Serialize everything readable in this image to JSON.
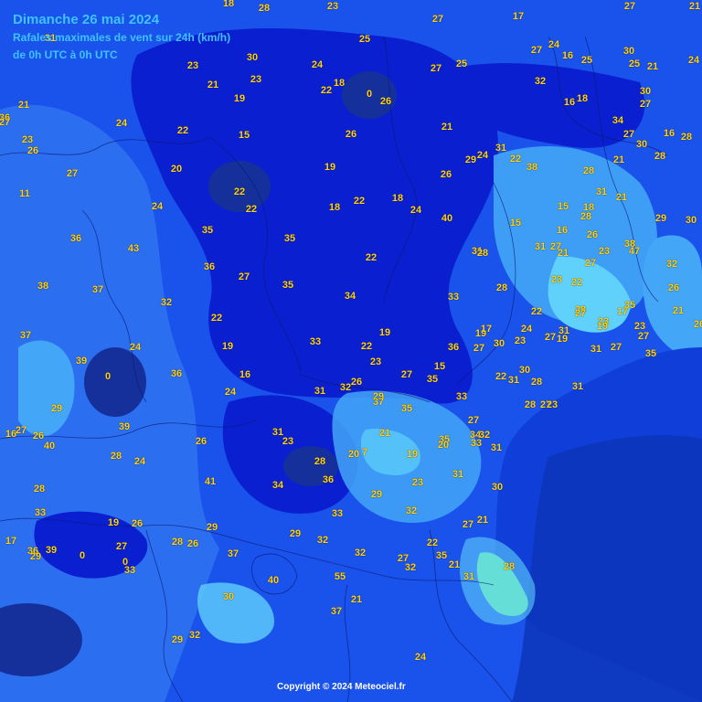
{
  "map": {
    "title": "Dimanche 26 mai 2024",
    "subtitle": "Rafales maximales de vent sur 24h (km/h)",
    "period": "de 0h UTC à 0h UTC",
    "copyright": "Copyright © 2024 Meteociel.fr",
    "colors": {
      "sea": "#0f3fd8",
      "land_base": "#1a52ec",
      "calm": "#0a1fd0",
      "very_calm": "#15309a",
      "moderate": "#2b78f2",
      "breezy": "#43a6f7",
      "windy": "#5fd1fb",
      "strong": "#6ef3a0",
      "label": "#ffd21a"
    },
    "values": [
      "18",
      "28",
      "23",
      "27",
      "17",
      "27",
      "21",
      "31",
      "25",
      "27",
      "24",
      "16",
      "30",
      "25",
      "25",
      "21",
      "24",
      "30",
      "23",
      "24",
      "25",
      "21",
      "23",
      "19",
      "22",
      "18",
      "0",
      "26",
      "27",
      "32",
      "16",
      "18",
      "30",
      "27",
      "21",
      "21",
      "24",
      "22",
      "15",
      "26",
      "34",
      "27",
      "16",
      "28",
      "30",
      "23",
      "26",
      "36",
      "27",
      "27",
      "20",
      "19",
      "26",
      "29",
      "24",
      "31",
      "22",
      "38",
      "28",
      "21",
      "28",
      "11",
      "22",
      "22",
      "24",
      "18",
      "22",
      "18",
      "24",
      "40",
      "15",
      "18",
      "28",
      "31",
      "21",
      "29",
      "30",
      "35",
      "35",
      "36",
      "43",
      "15",
      "16",
      "26",
      "31",
      "28",
      "31",
      "27",
      "21",
      "23",
      "38",
      "47",
      "32",
      "36",
      "27",
      "22",
      "23",
      "22",
      "27",
      "38",
      "37",
      "35",
      "34",
      "33",
      "28",
      "26",
      "32",
      "22",
      "22",
      "28",
      "27",
      "23",
      "19",
      "17",
      "35",
      "21",
      "23",
      "26",
      "19",
      "19",
      "17",
      "24",
      "27",
      "31",
      "19",
      "33",
      "22",
      "36",
      "27",
      "30",
      "23",
      "19",
      "31",
      "27",
      "27",
      "35",
      "37",
      "24",
      "39",
      "0",
      "36",
      "16",
      "23",
      "27",
      "15",
      "35",
      "22",
      "31",
      "30",
      "28",
      "31",
      "26",
      "32",
      "24",
      "31",
      "29",
      "37",
      "35",
      "33",
      "28",
      "27",
      "23",
      "29",
      "16",
      "26",
      "40",
      "39",
      "31",
      "23",
      "21",
      "35",
      "20",
      "27",
      "34",
      "32",
      "27",
      "26",
      "20",
      "7",
      "19",
      "33",
      "31",
      "28",
      "24",
      "34",
      "28",
      "36",
      "33",
      "23",
      "31",
      "30",
      "28",
      "41",
      "29",
      "32",
      "33",
      "19",
      "26",
      "29",
      "29",
      "32",
      "32",
      "22",
      "27",
      "21",
      "17",
      "36",
      "29",
      "39",
      "0",
      "27",
      "0",
      "33",
      "28",
      "26",
      "37",
      "55",
      "27",
      "32",
      "35",
      "21",
      "31",
      "28",
      "40",
      "37",
      "21",
      "30",
      "29",
      "32",
      "24"
    ]
  }
}
